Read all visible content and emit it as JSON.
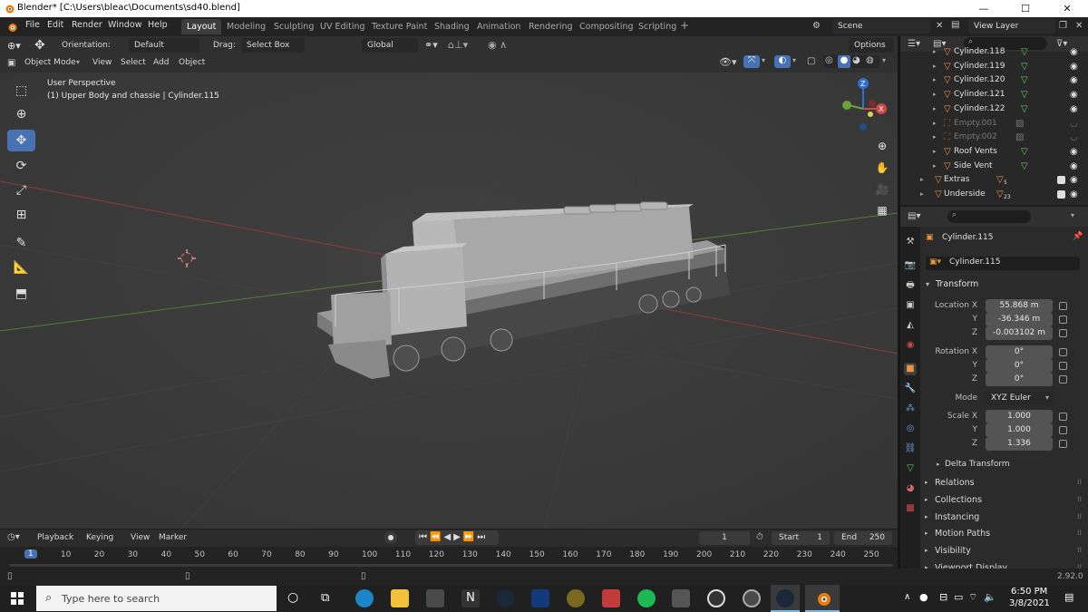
{
  "titlebar": {
    "title": "Blender* [C:\\Users\\bleac\\Documents\\sd40.blend]",
    "minimize": "—",
    "maximize": "☐",
    "close": "✕"
  },
  "menu": {
    "items": [
      "File",
      "Edit",
      "Render",
      "Window",
      "Help"
    ],
    "workspaces": [
      "Layout",
      "Modeling",
      "Sculpting",
      "UV Editing",
      "Texture Paint",
      "Shading",
      "Animation",
      "Rendering",
      "Compositing",
      "Scripting"
    ],
    "add_workspace": "+",
    "scene_label": "Scene",
    "view_layer_label": "View Layer"
  },
  "tool_header": {
    "orientation_label": "Orientation:",
    "orientation_value": "Default",
    "drag_label": "Drag:",
    "drag_value": "Select Box",
    "transform_space": "Global",
    "options_label": "Options"
  },
  "viewport_header": {
    "mode": "Object Mode",
    "menus": [
      "View",
      "Select",
      "Add",
      "Object"
    ]
  },
  "viewport": {
    "perspective": "User Perspective",
    "object_info": "(1) Upper Body and chassie | Cylinder.115"
  },
  "outliner": {
    "rows": [
      {
        "name": "Cylinder.118",
        "dim": false
      },
      {
        "name": "Cylinder.119",
        "dim": false
      },
      {
        "name": "Cylinder.120",
        "dim": false
      },
      {
        "name": "Cylinder.121",
        "dim": false
      },
      {
        "name": "Cylinder.122",
        "dim": false
      },
      {
        "name": "Empty.001",
        "dim": true
      },
      {
        "name": "Empty.002",
        "dim": true
      },
      {
        "name": "Roof Vents",
        "dim": false
      },
      {
        "name": "Side Vent",
        "dim": false
      },
      {
        "name": "Extras",
        "dim": false,
        "badge": "5"
      },
      {
        "name": "Underside",
        "dim": false,
        "badge": "23"
      }
    ]
  },
  "properties": {
    "object_name": "Cylinder.115",
    "object_field": "Cylinder.115",
    "transform_header": "Transform",
    "location_x_label": "Location X",
    "location_x": "55.868 m",
    "location_y_label": "Y",
    "location_y": "-36.346 m",
    "location_z_label": "Z",
    "location_z": "-0.003102 m",
    "rotation_x_label": "Rotation X",
    "rotation_x": "0°",
    "rotation_y_label": "Y",
    "rotation_y": "0°",
    "rotation_z_label": "Z",
    "rotation_z": "0°",
    "mode_label": "Mode",
    "mode_value": "XYZ Euler",
    "scale_x_label": "Scale X",
    "scale_x": "1.000",
    "scale_y_label": "Y",
    "scale_y": "1.000",
    "scale_z_label": "Z",
    "scale_z": "1.336",
    "delta_transform": "Delta Transform",
    "panels": [
      "Relations",
      "Collections",
      "Instancing",
      "Motion Paths",
      "Visibility",
      "Viewport Display"
    ]
  },
  "timeline": {
    "menus": [
      "Playback",
      "Keying",
      "View",
      "Marker"
    ],
    "current_frame": "1",
    "start_label": "Start",
    "start_value": "1",
    "end_label": "End",
    "end_value": "250",
    "ticks": [
      "1",
      "10",
      "20",
      "30",
      "40",
      "50",
      "60",
      "70",
      "80",
      "90",
      "100",
      "110",
      "120",
      "130",
      "140",
      "150",
      "160",
      "170",
      "180",
      "190",
      "200",
      "210",
      "220",
      "230",
      "240",
      "250"
    ]
  },
  "statusbar": {
    "version": "2.92.0"
  },
  "taskbar": {
    "search_placeholder": "Type here to search",
    "time": "6:50 PM",
    "date": "3/8/2021"
  },
  "colors": {
    "accent_blue": "#4772b3",
    "object_orange": "#e8953b",
    "mesh_green": "#6ac26a",
    "active_workspace": "#3d3d3d"
  }
}
